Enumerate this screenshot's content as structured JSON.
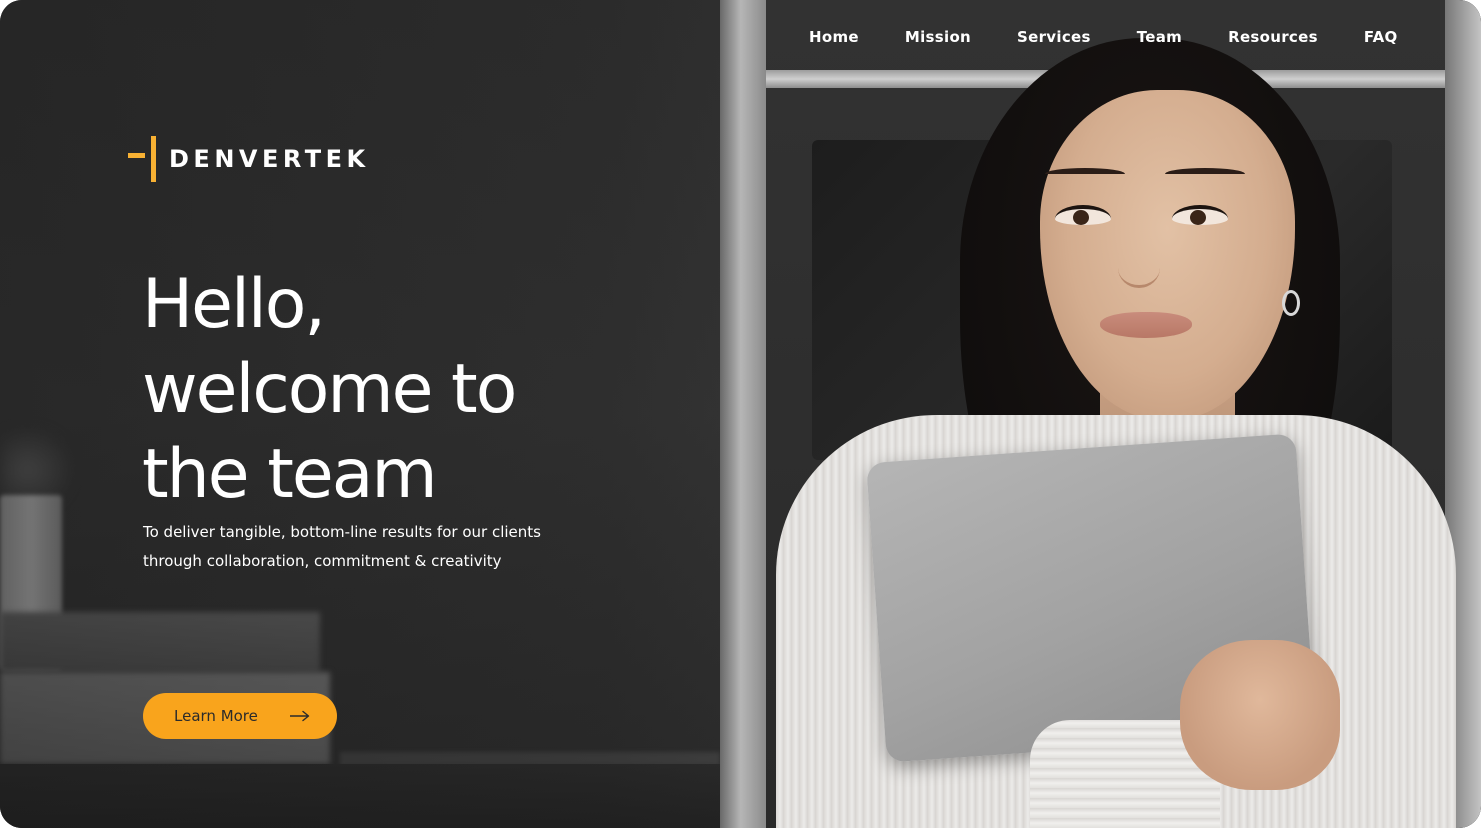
{
  "brand": {
    "name": "DENVERTEK",
    "accent_color": "#f8b133"
  },
  "nav": {
    "items": [
      {
        "label": "Home"
      },
      {
        "label": "Mission"
      },
      {
        "label": "Services"
      },
      {
        "label": "Team"
      },
      {
        "label": "Resources"
      },
      {
        "label": "FAQ"
      }
    ]
  },
  "hero": {
    "headline_lines": [
      "Hello,",
      "welcome to",
      "the team"
    ],
    "subtitle_lines": [
      "To deliver tangible, bottom-line results for our clients",
      "through collaboration, commitment & creativity"
    ],
    "cta": {
      "label": "Learn More",
      "icon": "arrow-right-icon",
      "color": "#f9a41c"
    }
  },
  "background_image": {
    "icon": "hero-photo-woman-holding-laptop"
  }
}
